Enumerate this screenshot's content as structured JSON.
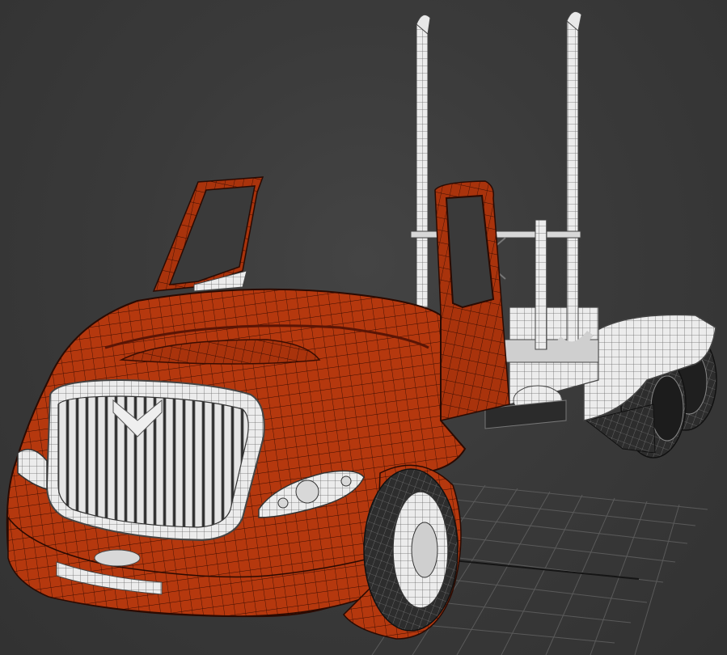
{
  "viewport": {
    "background_color": "#3a3a3a",
    "grid_color": "#5a5a5a",
    "grid_axis_color": "#1a1a1a"
  },
  "model": {
    "body_color": "#b5380e",
    "body_edge_color": "#2a0a02",
    "chrome_color": "#e8e8e8",
    "chrome_edge_color": "#555555",
    "tire_color": "#2b2b2b",
    "tire_edge_color": "#9a9a9a"
  }
}
